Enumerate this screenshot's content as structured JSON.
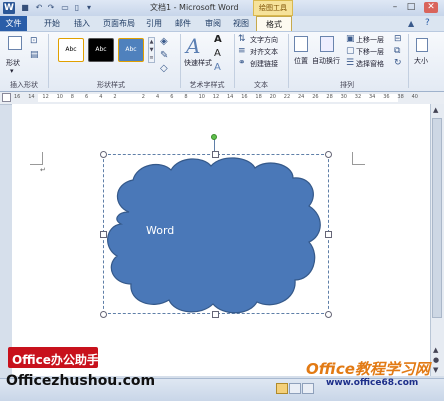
{
  "titlebar": {
    "app_icon": "W",
    "title": "文档1 - Microsoft Word",
    "context_tab": "绘图工具",
    "quick_access_icons": [
      "save-icon",
      "undo-icon",
      "redo-icon",
      "open-icon",
      "new-icon",
      "dropdown-icon"
    ],
    "window_controls": [
      "minimize-icon",
      "maximize-icon",
      "close-icon"
    ]
  },
  "tabs": [
    "文件",
    "开始",
    "插入",
    "页面布局",
    "引用",
    "邮件",
    "审阅",
    "视图",
    "格式"
  ],
  "ribbon": {
    "insert_shape": {
      "label": "形状",
      "group": "插入形状"
    },
    "shape_styles": {
      "group": "形状样式",
      "presets": [
        {
          "text": "Abc",
          "bg": "#ffffff",
          "fg": "#000000",
          "border": "#e0a000"
        },
        {
          "text": "Abc",
          "bg": "#000000",
          "fg": "#ffffff",
          "border": "#555555"
        },
        {
          "text": "Abc",
          "bg": "#4f81bd",
          "fg": "#ffffff",
          "border": "#e0a000"
        }
      ]
    },
    "wordart": {
      "group": "艺术字样式",
      "quick_styles": "快速样式",
      "letter": "A"
    },
    "text": {
      "group": "文本",
      "direction": "文字方向",
      "align": "对齐文本",
      "link": "创建链接"
    },
    "arrange": {
      "group": "排列",
      "position": "位置",
      "wrap": "自动换行",
      "bring_forward": "上移一层",
      "send_backward": "下移一层",
      "selection_pane": "选择窗格"
    },
    "size": {
      "label": "大小"
    }
  },
  "ruler": {
    "numbers": [
      "16",
      "14",
      "12",
      "10",
      "8",
      "6",
      "4",
      "2",
      "",
      "2",
      "4",
      "6",
      "8",
      "10",
      "12",
      "14",
      "16",
      "18",
      "20",
      "22",
      "24",
      "26",
      "28",
      "30",
      "32",
      "34",
      "36",
      "38",
      "40"
    ]
  },
  "document": {
    "cloud_text": "Word",
    "cloud_fill": "#4a78b8",
    "cloud_stroke": "#35598a"
  },
  "watermark": {
    "brand": "Office办公助手",
    "site_left": "Officezhushou.com",
    "site_right": "Office教程学习网",
    "site_right_url": "www.office68.com"
  }
}
